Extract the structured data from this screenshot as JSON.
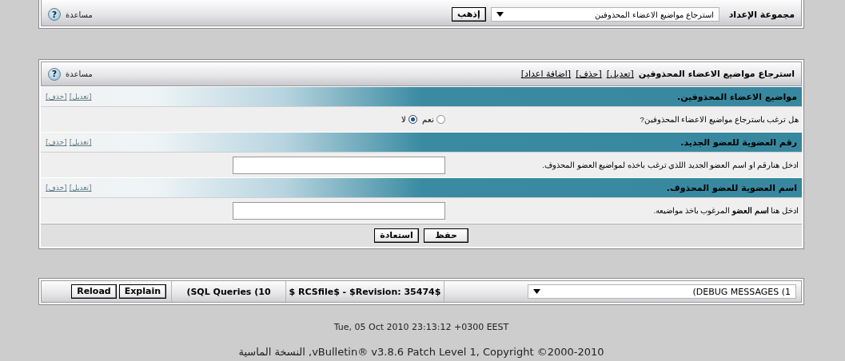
{
  "settings_group": {
    "label": "مجموعة الإعداد",
    "select_value": "استرجاع مواضيع الاعضاء المحذوفين",
    "go_button": "إذهب",
    "help": "مساعدة",
    "help_icon": "?"
  },
  "setting": {
    "title": "استرجاع مواضيع الاعضاء المحذوفين",
    "links": [
      "[تعديل]",
      "[حذف]",
      "[اضافة اعداد]"
    ],
    "help": "مساعدة",
    "help_icon": "?",
    "options": [
      {
        "kind": "radio",
        "title": "مواضيع الاعضاء المحذوفين.",
        "links": [
          "[تعديل]",
          "[حذف]"
        ],
        "description": "هل ترغب باسترجاع مواضيع الاعضاء المحذوفين?",
        "choices": [
          {
            "label": "نعم",
            "selected": false
          },
          {
            "label": "لا",
            "selected": true
          }
        ]
      },
      {
        "kind": "text",
        "title": "رقم العضوية للعضو الجديد.",
        "links": [
          "[تعديل]",
          "[حذف]"
        ],
        "description": "ادخل هنارقم او اسم العضو الجديد اللذي ترغب باخذه لمواضيع العضو المحذوف."
      },
      {
        "kind": "text",
        "title": "اسم العضوية للعضو المحذوف.",
        "links": [
          "[تعديل]",
          "[حذف]"
        ],
        "description": "ادخل هنا **اسم العضو** المرغوب باخذ مواضيعه."
      }
    ],
    "buttons": [
      "حفظ",
      "استعادة"
    ]
  },
  "debug": {
    "buttons": [
      "Explain",
      "Reload"
    ],
    "queries": "(SQL Queries (10",
    "revision": "$ RCSfile$ - $Revision: 35474$",
    "messages": "(DEBUG MESSAGES (1"
  },
  "footer": {
    "date": "Tue, 05 Oct 2010 23:13:12 +0300 EEST",
    "copyright": "النسخة الماسية ,vBulletin® v3.8.6 Patch Level 1, Copyright ©2000-2010"
  }
}
